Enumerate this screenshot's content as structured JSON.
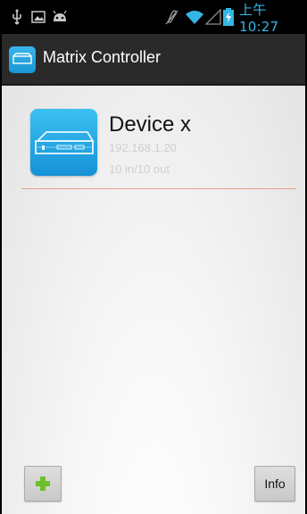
{
  "status_bar": {
    "time": "上午 10:27",
    "icons": [
      "usb-icon",
      "gallery-icon",
      "android-icon",
      "mute-icon",
      "wifi-icon",
      "signal-icon",
      "battery-icon"
    ],
    "accent_color": "#33b5e5"
  },
  "action_bar": {
    "title": "Matrix Controller",
    "background": "#2a2a2a"
  },
  "devices": [
    {
      "name": "Device x",
      "ip": "192.168.1.20",
      "io": "10 in/10 out",
      "icon": "rack-device-icon"
    }
  ],
  "buttons": {
    "add_icon": "plus-icon",
    "info_label": "Info"
  }
}
